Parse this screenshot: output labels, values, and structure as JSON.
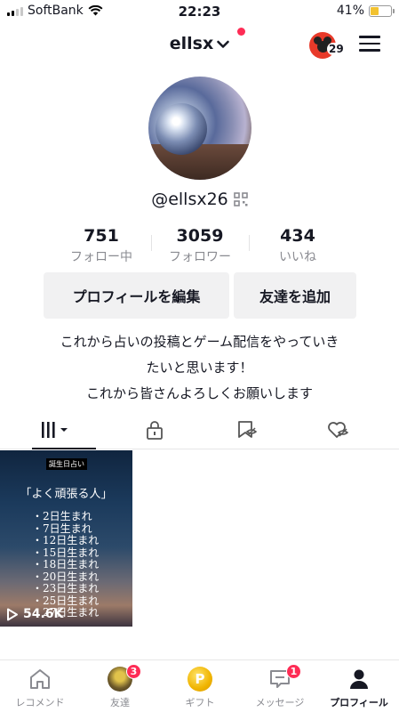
{
  "status_bar": {
    "carrier": "SoftBank",
    "time": "22:23",
    "battery": "41%",
    "battery_level": 0.41
  },
  "header": {
    "username": "ellsx",
    "badge_count": "29"
  },
  "profile": {
    "handle": "@ellsx26"
  },
  "stats": [
    {
      "value": "751",
      "label": "フォロー中"
    },
    {
      "value": "3059",
      "label": "フォロワー"
    },
    {
      "value": "434",
      "label": "いいね"
    }
  ],
  "buttons": {
    "edit": "プロフィールを編集",
    "add_friend": "友達を追加"
  },
  "bio": {
    "line1": "これから占いの投稿とゲーム配信をやっていき",
    "line2": "たいと思います！",
    "line3": "これから皆さんよろしくお願いします"
  },
  "video": {
    "tag": "誕生日占い",
    "title": "「よく頑張る人」",
    "items": [
      "・2日生まれ",
      "・7日生まれ",
      "・12日生まれ",
      "・15日生まれ",
      "・18日生まれ",
      "・20日生まれ",
      "・23日生まれ",
      "・25日生まれ",
      "・27日生まれ"
    ],
    "views": "54.6K"
  },
  "bottom_nav": [
    {
      "label": "レコメンド",
      "icon": "home-icon"
    },
    {
      "label": "友達",
      "icon": "friend-avatar",
      "badge": "3"
    },
    {
      "label": "ギフト",
      "icon": "coin-icon",
      "coin_letter": "P"
    },
    {
      "label": "メッセージ",
      "icon": "message-icon",
      "badge": "1"
    },
    {
      "label": "プロフィール",
      "icon": "profile-icon",
      "active": true
    }
  ]
}
